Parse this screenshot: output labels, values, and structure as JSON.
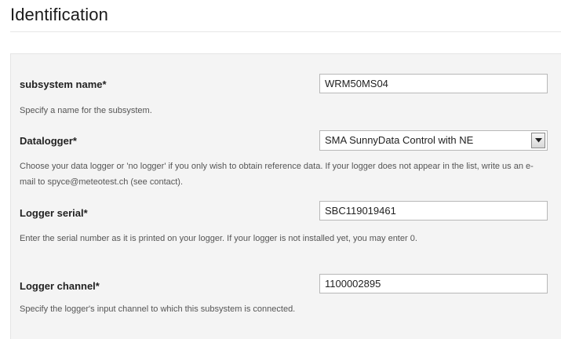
{
  "page": {
    "title": "Identification"
  },
  "form": {
    "subsystem_name": {
      "label": "subsystem name*",
      "value": "WRM50MS04",
      "help": "Specify a name for the subsystem."
    },
    "datalogger": {
      "label": "Datalogger*",
      "selected": "SMA SunnyData Control with NE",
      "help": "Choose your data logger or 'no logger' if you only wish to obtain reference data. If your logger does not appear in the list, write us an e-mail to spyce@meteotest.ch (see contact).",
      "dropdown_icon": "chevron-down-icon"
    },
    "logger_serial": {
      "label": "Logger serial*",
      "value": "SBC119019461",
      "help": "Enter the serial number as it is printed on your logger. If your logger is not installed yet, you may enter 0."
    },
    "logger_channel": {
      "label": "Logger channel*",
      "value": "1100002895",
      "help": "Specify the logger's input channel to which this subsystem is connected."
    }
  },
  "colors": {
    "panel_background": "#f4f4f4",
    "help_text": "#555555",
    "label_text": "#222222",
    "input_border": "#b8b8b8"
  }
}
